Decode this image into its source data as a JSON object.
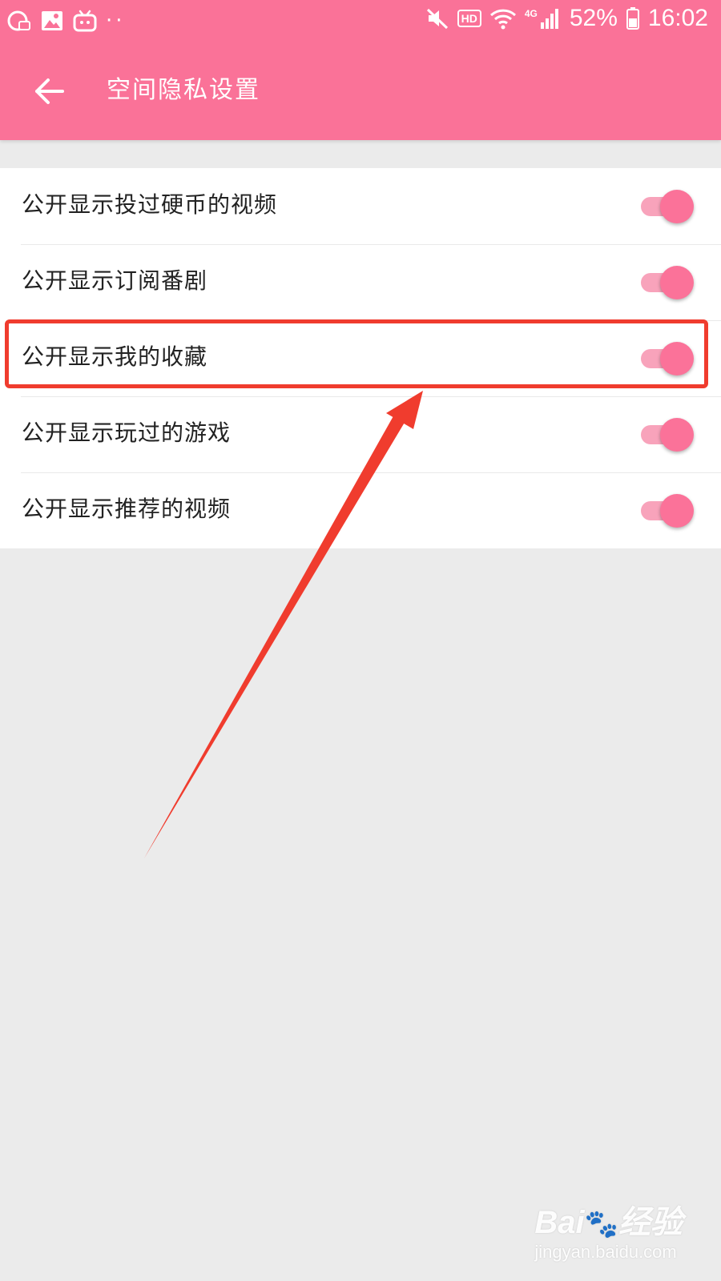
{
  "status_bar": {
    "battery": "52%",
    "time": "16:02",
    "hd_label": "HD",
    "network_label": "4G",
    "dots": "··",
    "left_icons": [
      "qq-icon",
      "image-icon",
      "bilibili-icon"
    ],
    "right_icons": [
      "mute-icon",
      "hd-icon",
      "wifi-icon",
      "signal-icon",
      "battery-icon"
    ]
  },
  "header": {
    "title": "空间隐私设置",
    "back_icon": "back-arrow-icon"
  },
  "settings": [
    {
      "label": "公开显示投过硬币的视频",
      "enabled": true
    },
    {
      "label": "公开显示订阅番剧",
      "enabled": true
    },
    {
      "label": "公开显示我的收藏",
      "enabled": true
    },
    {
      "label": "公开显示玩过的游戏",
      "enabled": true
    },
    {
      "label": "公开显示推荐的视频",
      "enabled": true
    }
  ],
  "watermark": {
    "logo_prefix": "Bai",
    "logo_paw": "🐾",
    "logo_suffix": "经验",
    "sub": "jingyan.baidu.com"
  },
  "colors": {
    "brand_pink": "#fa7298",
    "toggle_track": "#f8a3bb",
    "toggle_thumb": "#fb7299",
    "annotation_red": "#f03c2e",
    "background": "#ebebeb"
  }
}
